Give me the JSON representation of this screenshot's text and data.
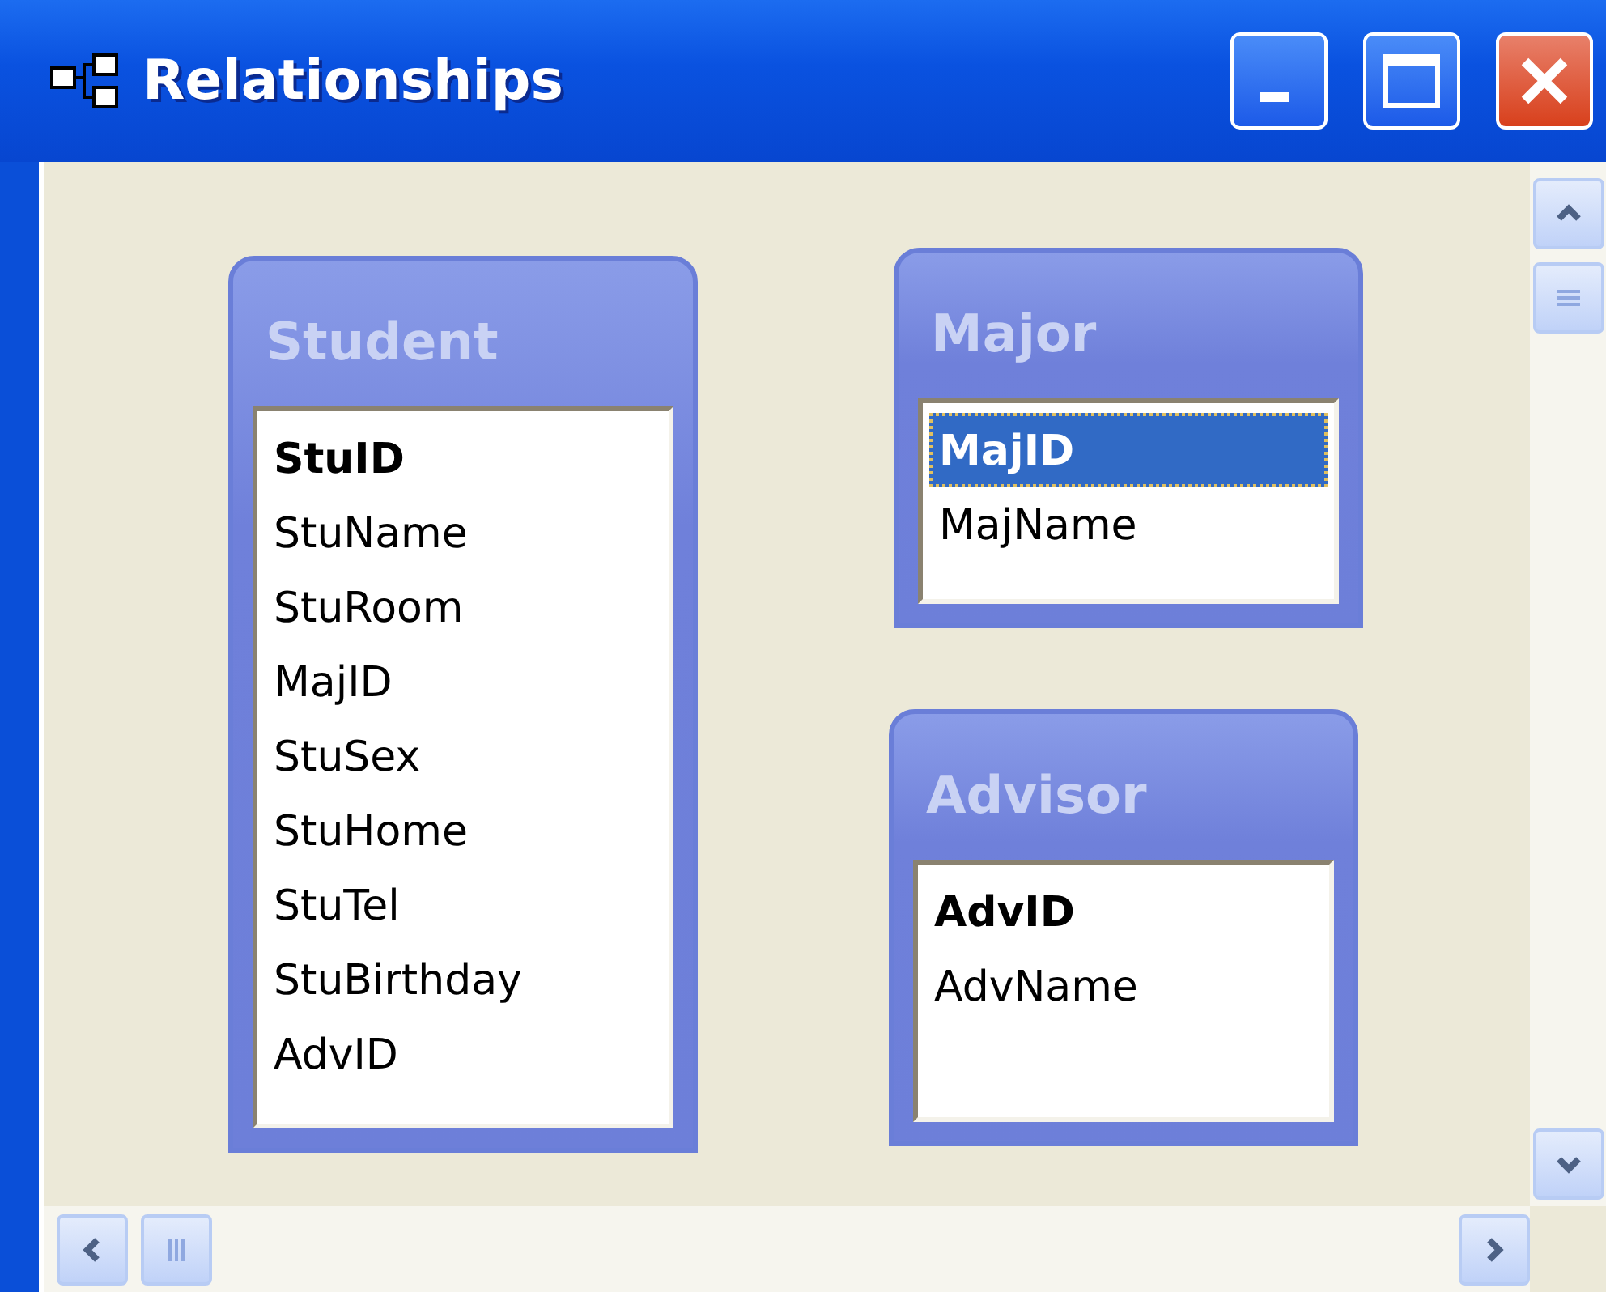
{
  "window": {
    "title": "Relationships"
  },
  "tables": [
    {
      "name": "Student",
      "fields": [
        {
          "name": "StuID",
          "kind": "key",
          "selected": false
        },
        {
          "name": "StuName",
          "kind": "field",
          "selected": false
        },
        {
          "name": "StuRoom",
          "kind": "field",
          "selected": false
        },
        {
          "name": "MajID",
          "kind": "field",
          "selected": false
        },
        {
          "name": "StuSex",
          "kind": "field",
          "selected": false
        },
        {
          "name": "StuHome",
          "kind": "field",
          "selected": false
        },
        {
          "name": "StuTel",
          "kind": "field",
          "selected": false
        },
        {
          "name": "StuBirthday",
          "kind": "field",
          "selected": false
        },
        {
          "name": "AdvID",
          "kind": "field",
          "selected": false
        }
      ]
    },
    {
      "name": "Major",
      "fields": [
        {
          "name": "MajID",
          "kind": "key",
          "selected": true
        },
        {
          "name": "MajName",
          "kind": "field",
          "selected": false
        }
      ]
    },
    {
      "name": "Advisor",
      "fields": [
        {
          "name": "AdvID",
          "kind": "key",
          "selected": false
        },
        {
          "name": "AdvName",
          "kind": "field",
          "selected": false
        }
      ]
    }
  ]
}
